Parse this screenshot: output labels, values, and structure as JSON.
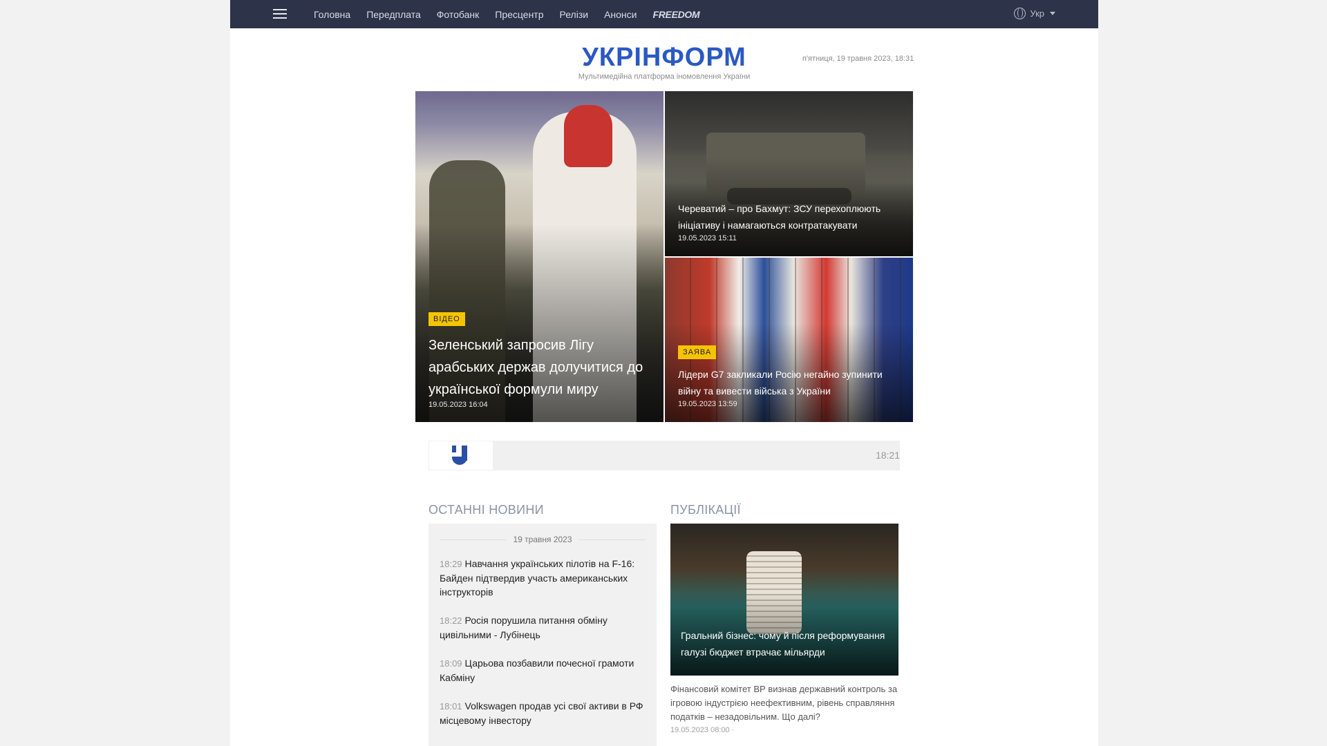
{
  "nav": {
    "menu_icon": "hamburger-icon",
    "links": [
      "Головна",
      "Передплата",
      "Фотобанк",
      "Пресцентр",
      "Релізи",
      "Анонси"
    ],
    "freedom": "FREEDOM",
    "lang": "Укр"
  },
  "header": {
    "logo": "УКРІНФОРМ",
    "tagline": "Мультимедійна платформа іномовлення України",
    "date": "п'ятниця, 19 травня 2023, 18:31"
  },
  "hero": {
    "main": {
      "badge": "Відео",
      "title": "Зеленський запросив Лігу арабських держав долучитися до української формули миру",
      "date": "19.05.2023 16:04"
    },
    "top": {
      "title": "Череватий – про Бахмут: ЗСУ перехоплюють ініціативу і намагаються контратакувати",
      "date": "19.05.2023 15:11"
    },
    "bottom": {
      "badge": "Заява",
      "title": "Лідери G7 закликали Росію негайно зупинити війну та вивести війська з України",
      "date": "19.05.2023 13:59"
    }
  },
  "live": {
    "time": "18:21"
  },
  "latest": {
    "heading": "Останні новини",
    "day": "19 травня 2023",
    "items": [
      {
        "time": "18:29",
        "title": "Навчання українських пілотів на F-16: Байден підтвердив участь американських інструкторів"
      },
      {
        "time": "18:22",
        "title": "Росія порушила питання обміну цивільними - Лубінець"
      },
      {
        "time": "18:09",
        "title": "Царьова позбавили почесної грамоти Кабміну"
      },
      {
        "time": "18:01",
        "title": "Volkswagen продав усі свої активи в РФ місцевому інвестору"
      }
    ]
  },
  "publications": {
    "heading": "Публікації",
    "title": "Гральний бізнес: чому й після реформування галузі бюджет втрачає мільярди",
    "lead": "Фінансовий комітет ВР визнав державний контроль за ігровою індустрією неефективним, рівень справляння податків – незадовільним. Що далі?",
    "date": "19.05.2023 08:00 ·"
  },
  "colors": {
    "nav_bg": "#2d3348",
    "brand_blue": "#2b59c3",
    "badge": "#f5c400"
  }
}
